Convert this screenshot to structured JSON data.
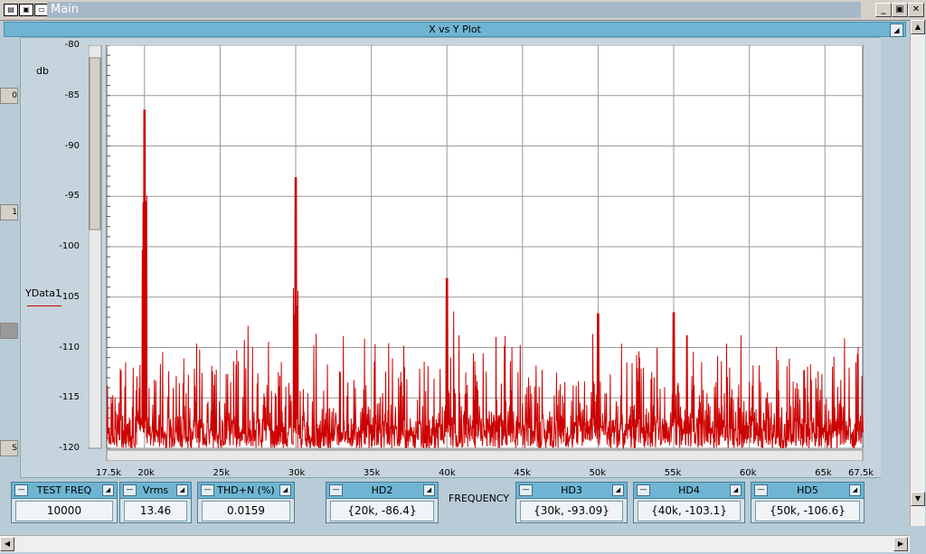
{
  "window": {
    "title": "Main",
    "min_label": "_",
    "restore_label": "▣",
    "close_label": "✕"
  },
  "plot": {
    "title": "X vs Y Plot",
    "ylabel": "db",
    "legend": "YData1",
    "xlabel": "FREQUENCY"
  },
  "left_stubs": [
    "0",
    "1",
    "",
    "S"
  ],
  "widgets": [
    {
      "name": "test-freq",
      "label": "TEST FREQ",
      "value": "10000"
    },
    {
      "name": "vrms",
      "label": "Vrms",
      "value": "13.46"
    },
    {
      "name": "thdn",
      "label": "THD+N (%)",
      "value": "0.0159"
    },
    {
      "name": "hd2",
      "label": "HD2",
      "value": "{20k, -86.4}"
    },
    {
      "name": "hd3",
      "label": "HD3",
      "value": "{30k, -93.09}"
    },
    {
      "name": "hd4",
      "label": "HD4",
      "value": "{40k, -103.1}"
    },
    {
      "name": "hd5",
      "label": "HD5",
      "value": "{50k, -106.6}"
    }
  ],
  "colors": {
    "trace": "#cc0000",
    "header": "#6fb5d3",
    "panel": "#b9cbd6"
  },
  "chart_data": {
    "type": "line",
    "title": "X vs Y Plot",
    "xlabel": "FREQUENCY",
    "ylabel": "db",
    "xlim": [
      17500,
      67500
    ],
    "ylim": [
      -120,
      -80
    ],
    "xticks": [
      "17.5k",
      "20k",
      "25k",
      "30k",
      "35k",
      "40k",
      "45k",
      "50k",
      "55k",
      "60k",
      "65k",
      "67.5k"
    ],
    "yticks": [
      "-80",
      "-85",
      "-90",
      "-95",
      "-100",
      "-105",
      "-110",
      "-115",
      "-120"
    ],
    "grid": true,
    "series": [
      {
        "name": "YData1",
        "peaks": [
          [
            20000,
            -86.4
          ],
          [
            30000,
            -93.1
          ],
          [
            40000,
            -103.1
          ],
          [
            50000,
            -106.6
          ],
          [
            55000,
            -106.5
          ]
        ],
        "noise_floor": -115
      }
    ]
  }
}
